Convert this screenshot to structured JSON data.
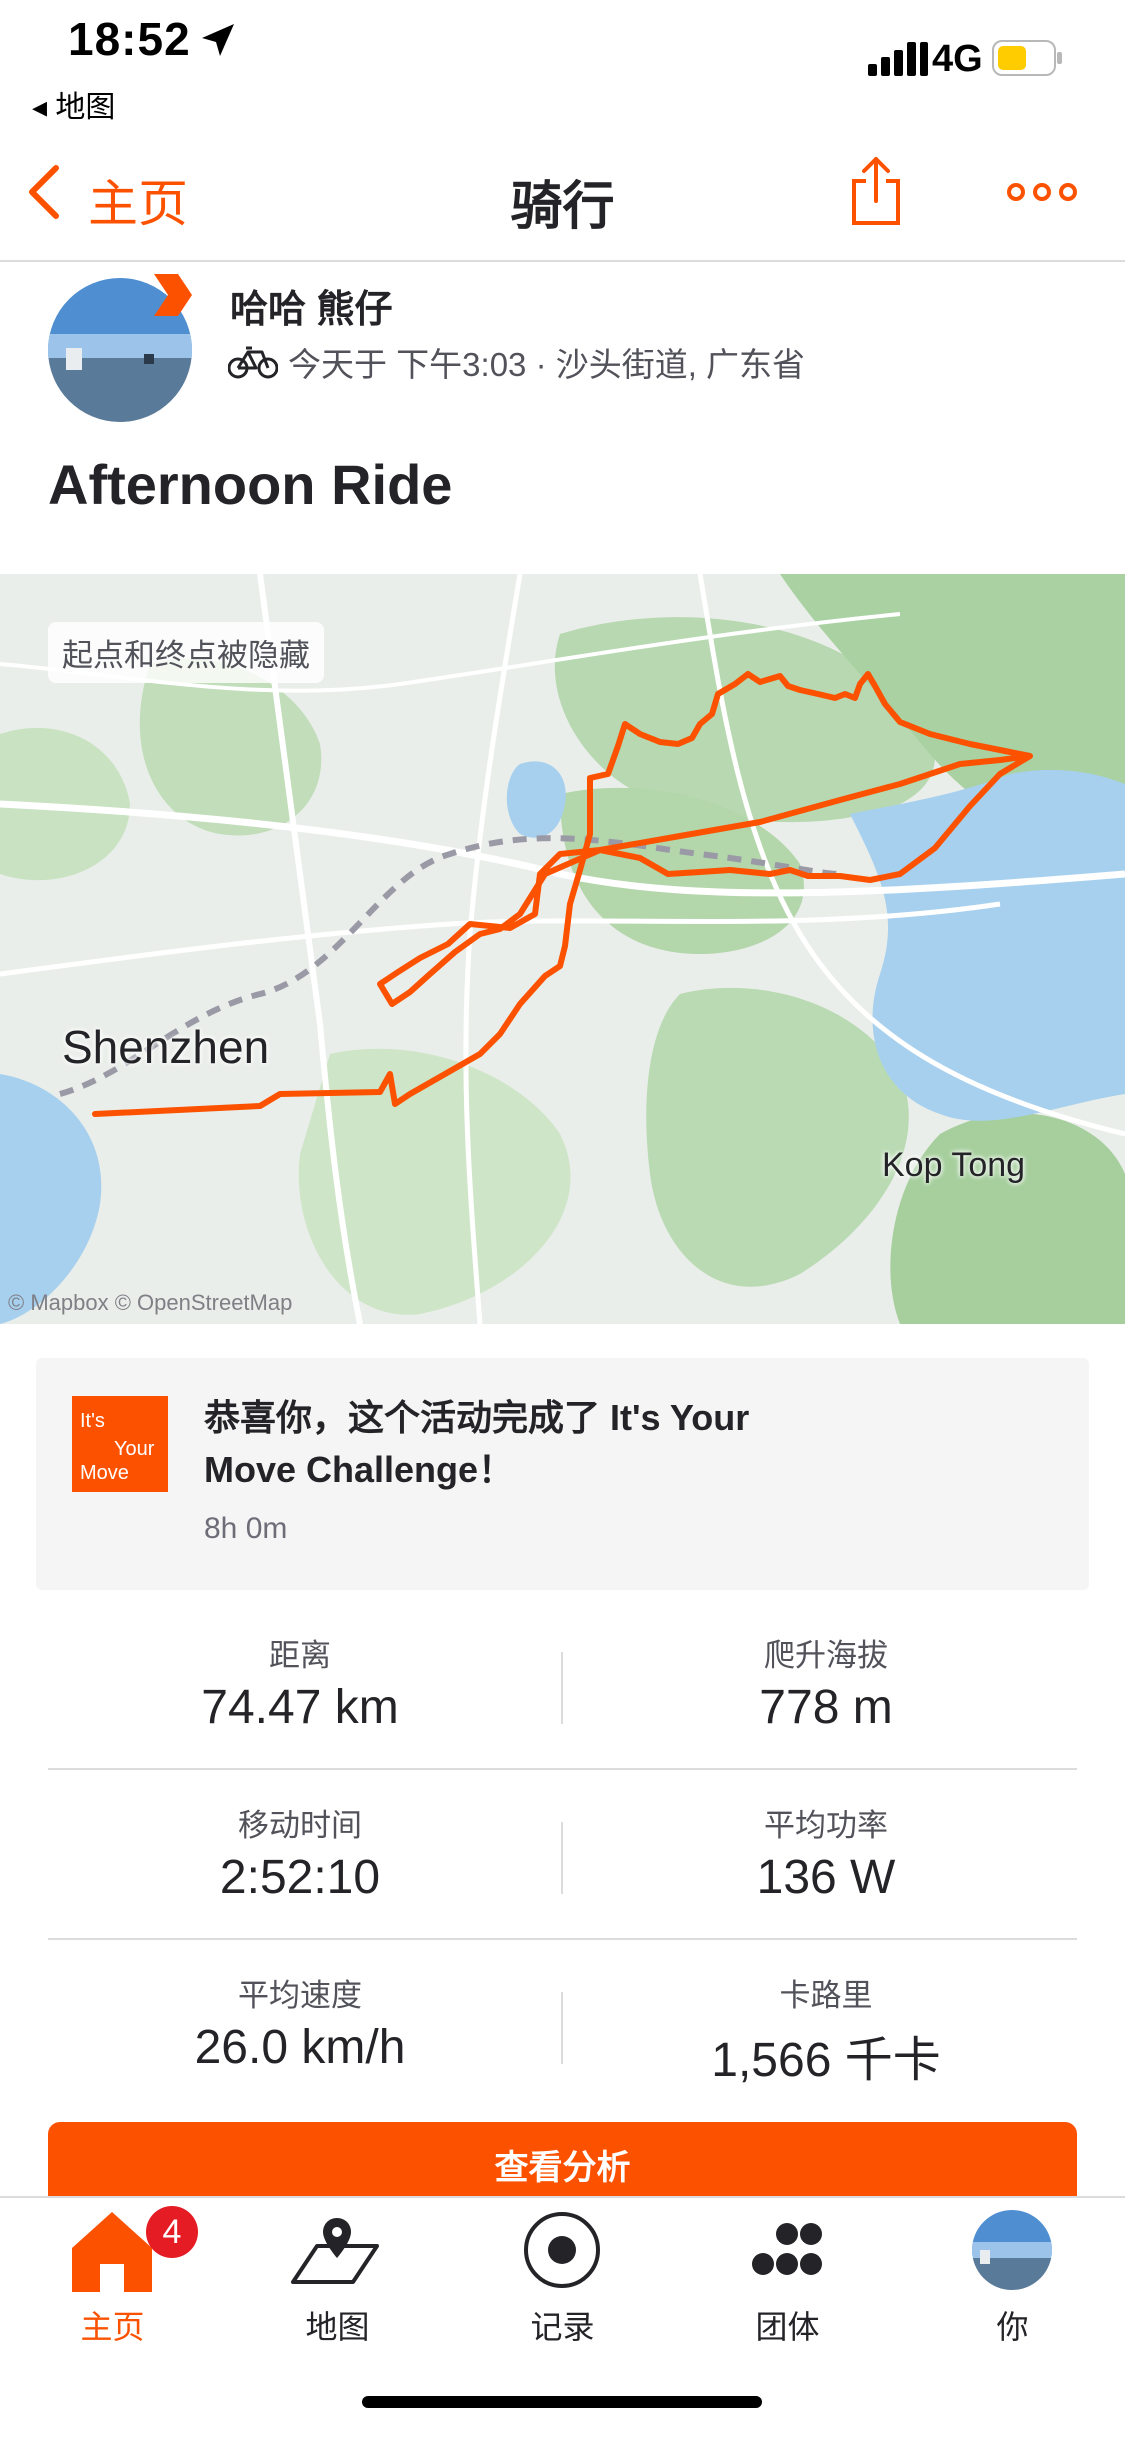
{
  "status_bar": {
    "time": "18:52",
    "back_app": "◂ 地图",
    "network": "4G"
  },
  "nav": {
    "back_label": "主页",
    "title": "骑行"
  },
  "activity": {
    "athlete_name": "哈哈 熊仔",
    "meta": "今天于 下午3:03 · 沙头街道, 广东省",
    "title": "Afternoon Ride"
  },
  "map": {
    "privacy_tag": "起点和终点被隐藏",
    "city_label": "Shenzhen",
    "place_label": "Kop Tong",
    "attribution": "© Mapbox © OpenStreetMap",
    "route_color": "#fc5200"
  },
  "challenge": {
    "text": "恭喜你，这个活动完成了 It's Your Move Challenge！",
    "duration": "8h 0m",
    "badge_words": [
      "It's",
      "Your",
      "Move"
    ]
  },
  "stats": [
    {
      "label": "距离",
      "value": "74.47 km"
    },
    {
      "label": "爬升海拔",
      "value": "778 m"
    },
    {
      "label": "移动时间",
      "value": "2:52:10"
    },
    {
      "label": "平均功率",
      "value": "136 W"
    },
    {
      "label": "平均速度",
      "value": "26.0 km/h"
    },
    {
      "label": "卡路里",
      "value": "1,566 千卡"
    }
  ],
  "cta": {
    "label": "查看分析"
  },
  "tabbar": {
    "home_badge": "4",
    "tabs": [
      {
        "label": "主页",
        "icon": "home-icon",
        "active": true
      },
      {
        "label": "地图",
        "icon": "map-icon",
        "active": false
      },
      {
        "label": "记录",
        "icon": "record-icon",
        "active": false
      },
      {
        "label": "团体",
        "icon": "groups-icon",
        "active": false
      },
      {
        "label": "你",
        "icon": "profile-avatar",
        "active": false
      }
    ]
  },
  "colors": {
    "accent": "#fc5200",
    "text": "#242428",
    "muted": "#52525a"
  }
}
